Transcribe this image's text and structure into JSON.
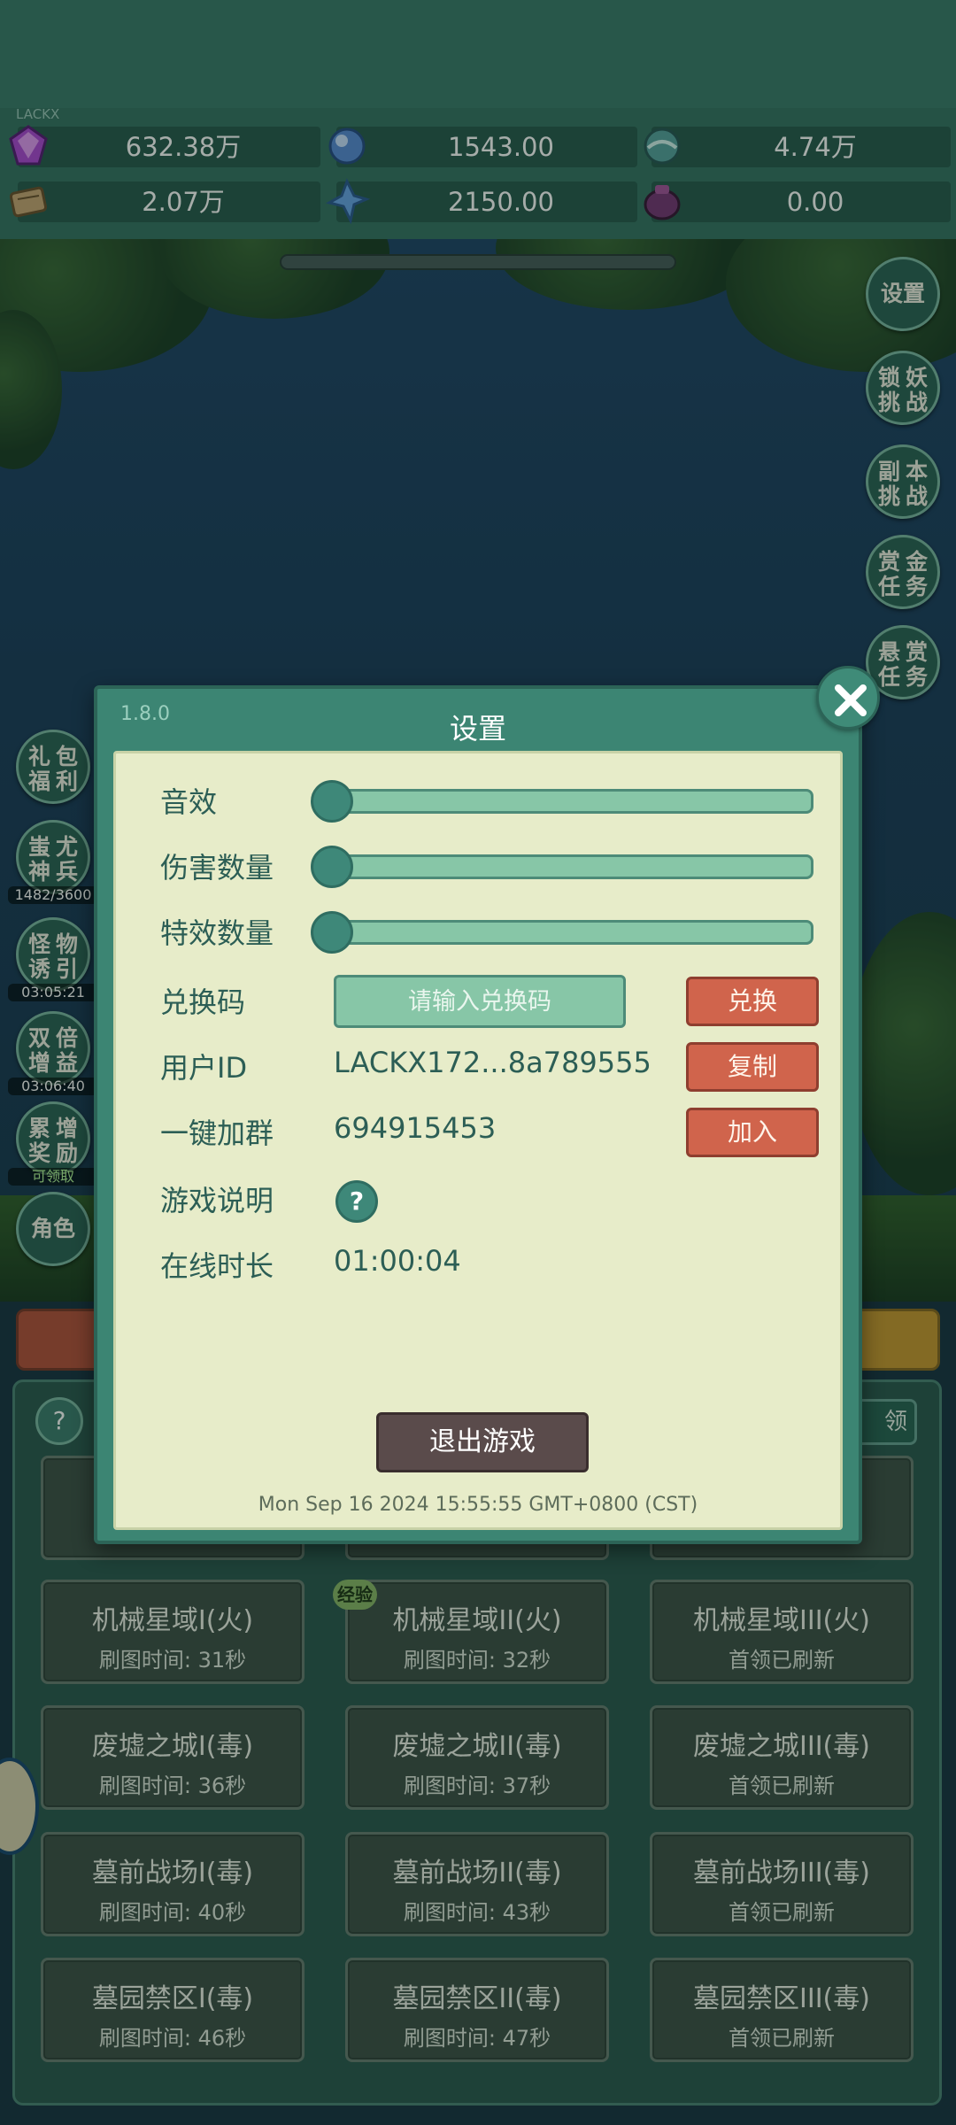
{
  "header": {
    "player_tag": "LACKX"
  },
  "resources": [
    {
      "icon": "purple-gem-icon",
      "value": "632.38万"
    },
    {
      "icon": "blue-crystal-icon",
      "value": "1543.00"
    },
    {
      "icon": "teal-orb-icon",
      "value": "4.74万"
    },
    {
      "icon": "scroll-icon",
      "value": "2.07万"
    },
    {
      "icon": "ice-shard-icon",
      "value": "2150.00"
    },
    {
      "icon": "dark-pouch-icon",
      "value": "0.00"
    }
  ],
  "right_menu": [
    {
      "label": "设置"
    },
    {
      "line1": "锁妖",
      "line2": "挑战"
    },
    {
      "line1": "副本",
      "line2": "挑战"
    },
    {
      "line1": "赏金",
      "line2": "任务"
    },
    {
      "line1": "悬赏",
      "line2": "任务"
    }
  ],
  "left_menu": [
    {
      "line1": "礼包",
      "line2": "福利",
      "sub": ""
    },
    {
      "line1": "蚩尤",
      "line2": "神兵",
      "sub": "1482/3600"
    },
    {
      "line1": "怪物",
      "line2": "诱引",
      "sub": "03:05:21"
    },
    {
      "line1": "双倍",
      "line2": "增益",
      "sub": "03:06:40"
    },
    {
      "line1": "累增",
      "line2": "奖励",
      "sub": "可领取"
    },
    {
      "label": "角色"
    }
  ],
  "bottom": {
    "help": "?",
    "collect_label": "领",
    "exp_badge": "经验",
    "maps": [
      {
        "name": "机械星域I(火)",
        "time": "刷图时间: 31秒"
      },
      {
        "name": "机械星域II(火)",
        "time": "刷图时间: 32秒"
      },
      {
        "name": "机械星域III(火)",
        "time": "首领已刷新"
      },
      {
        "name": "废墟之城I(毒)",
        "time": "刷图时间: 36秒"
      },
      {
        "name": "废墟之城II(毒)",
        "time": "刷图时间: 37秒"
      },
      {
        "name": "废墟之城III(毒)",
        "time": "首领已刷新"
      },
      {
        "name": "墓前战场I(毒)",
        "time": "刷图时间: 40秒"
      },
      {
        "name": "墓前战场II(毒)",
        "time": "刷图时间: 43秒"
      },
      {
        "name": "墓前战场III(毒)",
        "time": "首领已刷新"
      },
      {
        "name": "墓园禁区I(毒)",
        "time": "刷图时间: 46秒"
      },
      {
        "name": "墓园禁区II(毒)",
        "time": "刷图时间: 47秒"
      },
      {
        "name": "墓园禁区III(毒)",
        "time": "首领已刷新"
      }
    ]
  },
  "settings": {
    "version": "1.8.0",
    "title": "设置",
    "sound_label": "音效",
    "sound_level": 0,
    "damage_label": "伤害数量",
    "damage_level": 0,
    "effects_label": "特效数量",
    "effects_level": 0,
    "redeem_label": "兑换码",
    "redeem_placeholder": "请输入兑换码",
    "redeem_button": "兑换",
    "userid_label": "用户ID",
    "userid_value": "LACKX172...8a789555",
    "copy_button": "复制",
    "group_label": "一键加群",
    "group_value": "694915453",
    "join_button": "加入",
    "guide_label": "游戏说明",
    "guide_icon": "?",
    "online_label": "在线时长",
    "online_value": "01:00:04",
    "exit_button": "退出游戏",
    "datetime": "Mon Sep 16 2024 15:55:55 GMT+0800 (CST)"
  }
}
